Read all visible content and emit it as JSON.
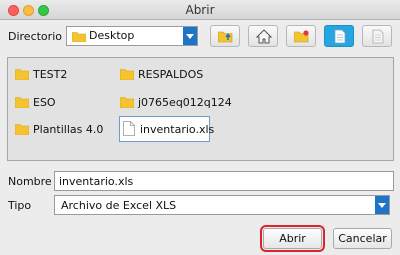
{
  "window": {
    "title": "Abrir"
  },
  "directory": {
    "label": "Directorio",
    "value": "Desktop"
  },
  "toolbar": {
    "up_icon": "up-one-level-icon",
    "home_icon": "home-icon",
    "new_folder_icon": "new-folder-icon",
    "list_view_icon": "list-view-icon",
    "details_view_icon": "details-view-icon"
  },
  "files": [
    {
      "name": "TEST2",
      "type": "folder"
    },
    {
      "name": "RESPALDOS",
      "type": "folder"
    },
    {
      "name": "ESO",
      "type": "folder"
    },
    {
      "name": "j0765eq012q124",
      "type": "folder"
    },
    {
      "name": "Plantillas 4.0",
      "type": "folder"
    },
    {
      "name": "inventario.xls",
      "type": "file",
      "selected": true
    }
  ],
  "filename": {
    "label": "Nombre",
    "value": "inventario.xls"
  },
  "filetype": {
    "label": "Tipo",
    "value": "Archivo de Excel XLS"
  },
  "buttons": {
    "open": "Abrir",
    "cancel": "Cancelar"
  },
  "colors": {
    "accent": "#1e74c9",
    "active_toolbar": "#25a6e0",
    "folder": "#f4c430",
    "focus_outline": "#d9262b"
  }
}
